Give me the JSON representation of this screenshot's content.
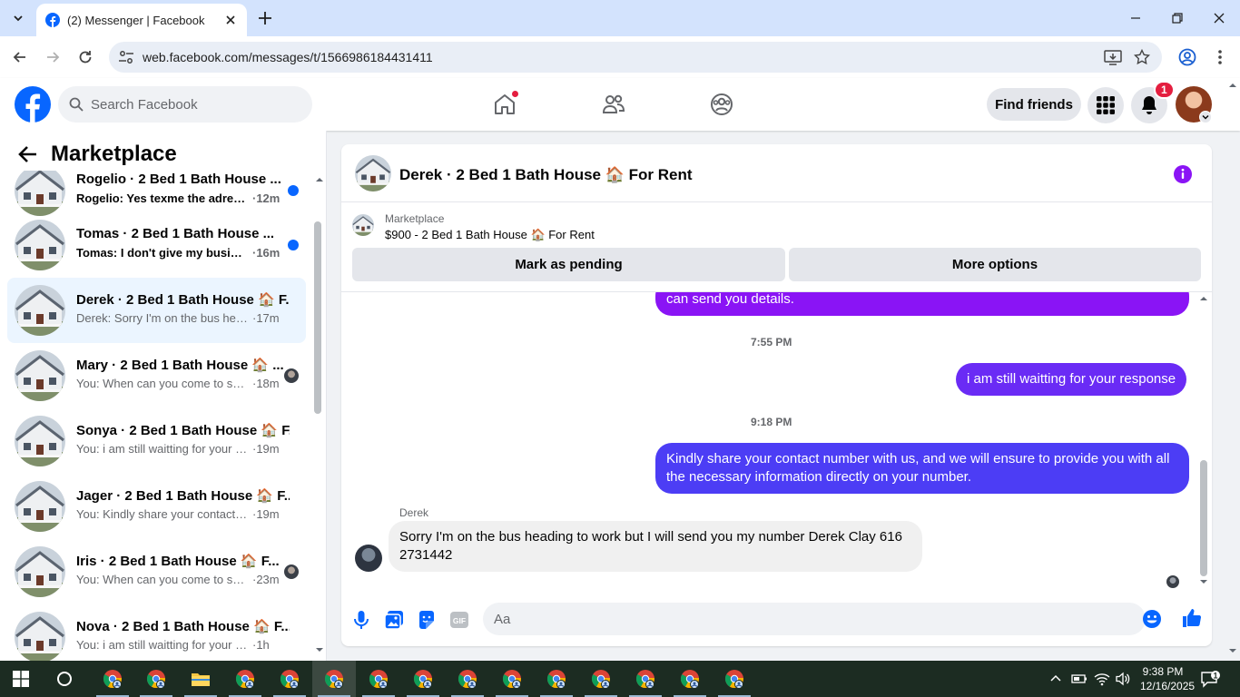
{
  "browser": {
    "tab_title": "(2) Messenger | Facebook",
    "url": "web.facebook.com/messages/t/1566986184431411"
  },
  "header": {
    "search_placeholder": "Search Facebook",
    "find_friends": "Find friends",
    "notification_count": "1"
  },
  "sidebar": {
    "title": "Marketplace",
    "conversations": [
      {
        "name": "Rogelio · 2 Bed 1 Bath House ...",
        "preview": "Rogelio: Yes texme the adress ...",
        "time": "·12m"
      },
      {
        "name": "Tomas · 2 Bed 1 Bath House ...",
        "preview": "Tomas: I don't give my busine...",
        "time": "·16m"
      },
      {
        "name": "Derek · 2 Bed 1 Bath House 🏠 F...",
        "preview": "Derek: Sorry I'm on the bus headi...",
        "time": "·17m"
      },
      {
        "name": "Mary · 2 Bed 1 Bath House 🏠 ...",
        "preview": "You: When can you come to se...",
        "time": "·18m"
      },
      {
        "name": "Sonya · 2 Bed 1 Bath House 🏠 F...",
        "preview": "You: i am still waitting for your re...",
        "time": "·19m"
      },
      {
        "name": "Jager · 2 Bed 1 Bath House 🏠 F...",
        "preview": "You: Kindly share your contact nu...",
        "time": "·19m"
      },
      {
        "name": "Iris · 2 Bed 1 Bath House 🏠 F...",
        "preview": "You: When can you come to se...",
        "time": "·23m"
      },
      {
        "name": "Nova · 2 Bed 1 Bath House 🏠 F...",
        "preview": "You: i am still waitting for your resp...",
        "time": "·1h"
      }
    ]
  },
  "chat": {
    "title": "Derek · 2 Bed 1 Bath House 🏠 For Rent",
    "marketplace_label": "Marketplace",
    "listing": "$900 - 2 Bed 1 Bath House 🏠 For Rent",
    "mark_pending": "Mark as pending",
    "more_options": "More options",
    "messages": {
      "partial_out": "can send you  details.",
      "time1": "7:55 PM",
      "out1": "i am still waitting for your response",
      "time2": "9:18 PM",
      "out2": "Kindly share your contact number with us, and we will ensure to provide you with all the necessary information directly on your number.",
      "sender": "Derek",
      "in1": "Sorry I'm on the bus heading to work but I will send you my number  Derek Clay  616 2731442"
    },
    "composer_placeholder": "Aa"
  },
  "taskbar": {
    "time": "9:38 PM",
    "date": "12/16/2025",
    "notif_count": "1"
  },
  "colors": {
    "fb_blue": "#0866ff",
    "bubble_purple": "#8a14f5",
    "bubble_indigo": "#4c3df5",
    "unread_dot": "#0866ff",
    "badge_red": "#e41e3f"
  }
}
